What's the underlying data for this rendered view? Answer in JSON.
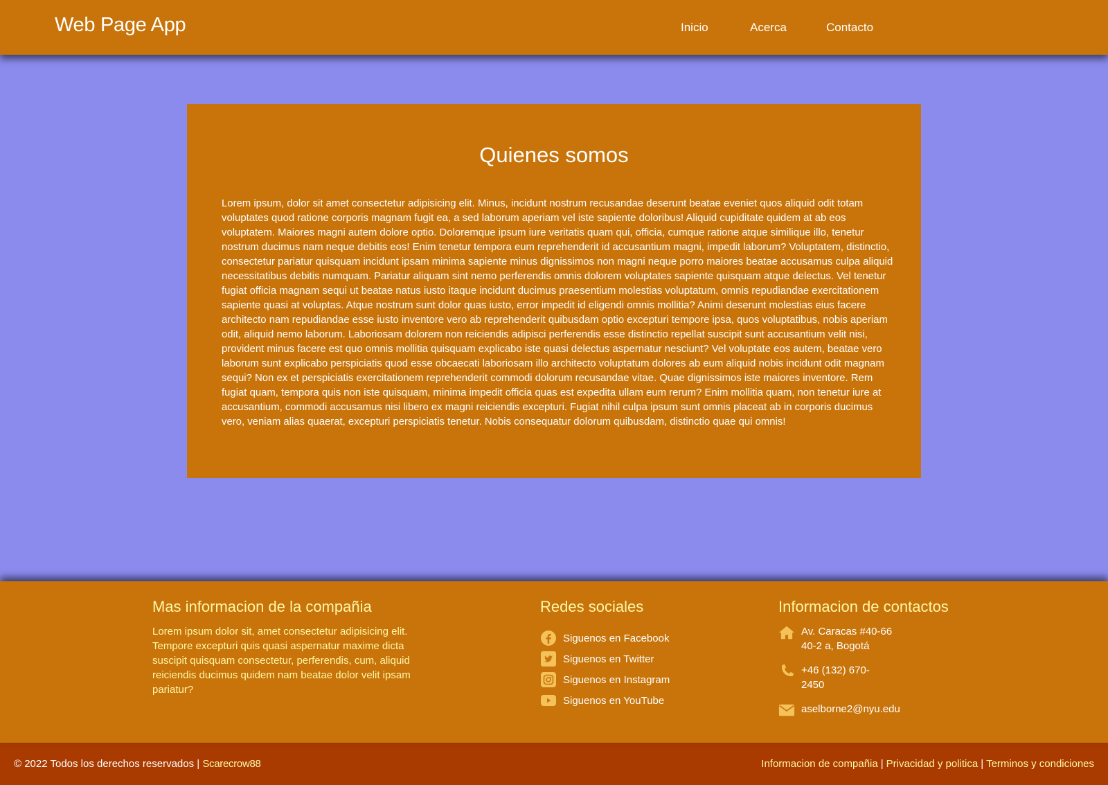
{
  "header": {
    "brand": "Web Page App",
    "nav": [
      "Inicio",
      "Acerca",
      "Contacto"
    ]
  },
  "main": {
    "title": "Quienes somos",
    "body": "Lorem ipsum, dolor sit amet consectetur adipisicing elit. Minus, incidunt nostrum recusandae deserunt beatae eveniet quos aliquid odit totam voluptates quod ratione corporis magnam fugit ea, a sed laborum aperiam vel iste sapiente doloribus! Aliquid cupiditate quidem at ab eos voluptatem. Maiores magni autem dolore optio. Doloremque ipsum iure veritatis quam qui, officia, cumque ratione atque similique illo, tenetur nostrum ducimus nam neque debitis eos! Enim tenetur tempora eum reprehenderit id accusantium magni, impedit laborum? Voluptatem, distinctio, consectetur pariatur quisquam incidunt ipsam minima sapiente minus dignissimos non magni neque porro maiores beatae accusamus culpa aliquid necessitatibus debitis numquam. Pariatur aliquam sint nemo perferendis omnis dolorem voluptates sapiente quisquam atque delectus. Vel tenetur fugiat officia magnam sequi ut beatae natus iusto itaque incidunt ducimus praesentium molestias voluptatum, omnis repudiandae exercitationem sapiente quasi at voluptas. Atque nostrum sunt dolor quas iusto, error impedit id eligendi omnis mollitia? Animi deserunt molestias eius facere architecto nam repudiandae esse iusto inventore vero ab reprehenderit quibusdam optio excepturi tempore ipsa, quos voluptatibus, nobis aperiam odit, aliquid nemo laborum. Laboriosam dolorem non reiciendis adipisci perferendis esse distinctio repellat suscipit sunt accusantium velit nisi, provident minus facere est quo omnis mollitia quisquam explicabo iste quasi delectus aspernatur nesciunt? Vel voluptate eos autem, beatae vero laborum sunt explicabo perspiciatis quod esse obcaecati laboriosam illo architecto voluptatum dolores ab eum aliquid nobis incidunt odit magnam sequi? Non ex et perspiciatis exercitationem reprehenderit commodi dolorum recusandae vitae. Quae dignissimos iste maiores inventore. Rem fugiat quam, tempora quis non iste quisquam, minima impedit officia quas est expedita ullam eum rerum? Enim mollitia quam, non tenetur iure at accusantium, commodi accusamus nisi libero ex magni reiciendis excepturi. Fugiat nihil culpa ipsum sunt omnis placeat ab in corporis ducimus vero, veniam alias quaerat, excepturi perspiciatis tenetur. Nobis consequatur dolorum quibusdam, distinctio quae qui omnis!"
  },
  "footer": {
    "company": {
      "title": "Mas informacion de la compañia",
      "text": "Lorem ipsum dolor sit, amet consectetur adipisicing elit. Tempore excepturi quis quasi aspernatur maxime dicta suscipit quisquam consectetur, perferendis, cum, aliquid reiciendis ducimus quidem nam beatae dolor velit ipsam pariatur?"
    },
    "social": {
      "title": "Redes sociales",
      "items": [
        {
          "icon": "facebook-icon",
          "label": "Siguenos en Facebook"
        },
        {
          "icon": "twitter-icon",
          "label": "Siguenos en Twitter"
        },
        {
          "icon": "instagram-icon",
          "label": "Siguenos en Instagram"
        },
        {
          "icon": "youtube-icon",
          "label": "Siguenos en YouTube"
        }
      ]
    },
    "contact": {
      "title": "Informacion de contactos",
      "address_line1": "Av. Caracas #40-66",
      "address_line2": "40-2 a, Bogotá",
      "phone_line1": "+46 (132) 670-",
      "phone_line2": "2450",
      "email": "aselborne2@nyu.edu"
    }
  },
  "bottom": {
    "copyright": "© 2022 Todos los derechos reservados |",
    "author": "Scarecrow88",
    "links": [
      "Informacion de compañia",
      "Privacidad y politica",
      "Terminos y condiciones"
    ],
    "separator": "|"
  },
  "colors": {
    "page_background": "#8b8bee",
    "header_footer": "#c8740a",
    "bottom_bar": "#a93a00",
    "accent_text": "#fff7a8",
    "icon": "#f5c25a"
  }
}
